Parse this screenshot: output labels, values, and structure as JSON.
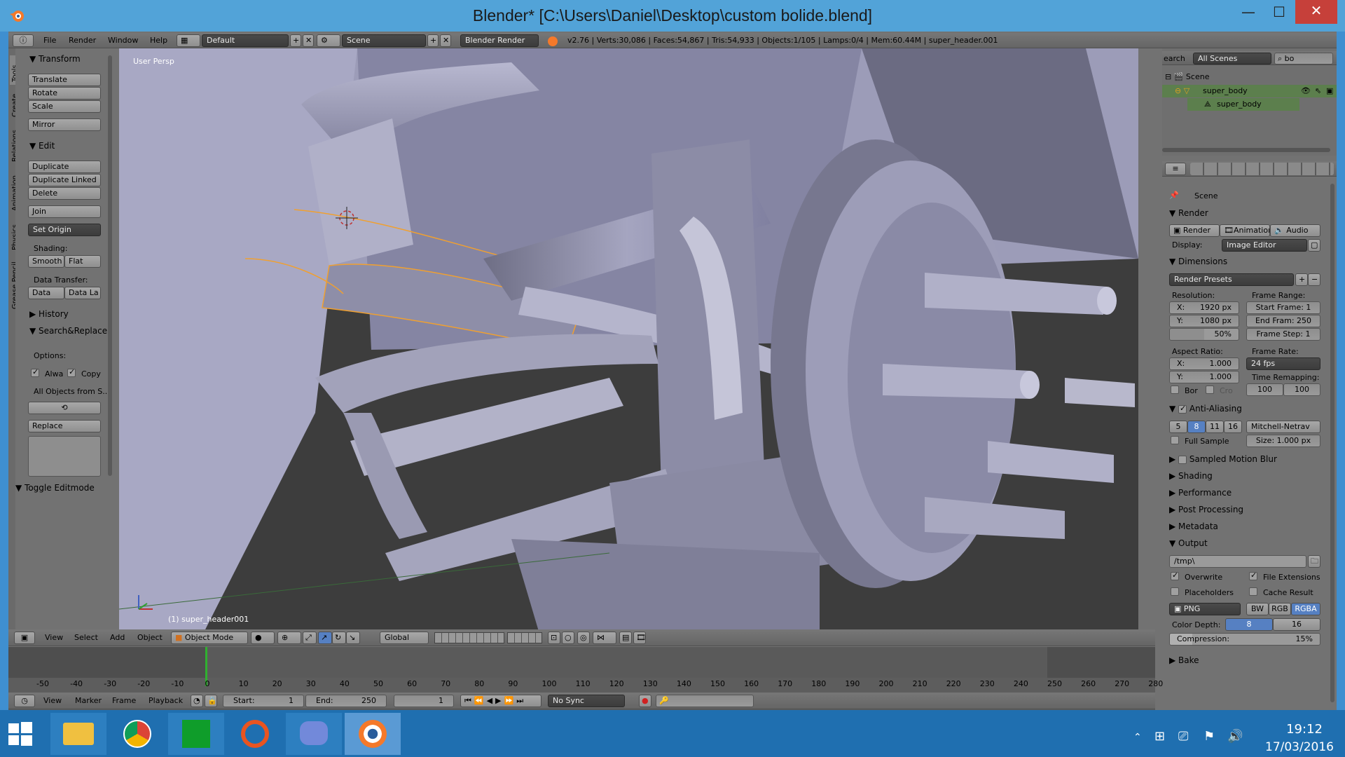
{
  "window": {
    "title": "Blender* [C:\\Users\\Daniel\\Desktop\\custom bolide.blend]"
  },
  "menubar": {
    "items": [
      "File",
      "Render",
      "Window",
      "Help"
    ],
    "layout": "Default",
    "scene": "Scene",
    "engine": "Blender Render",
    "stats": "v2.76 | Verts:30,086 | Faces:54,867 | Tris:54,933 | Objects:1/105 | Lamps:0/4 | Mem:60.44M | super_header.001"
  },
  "tools": {
    "tabs": [
      "Tools",
      "Create",
      "Relations",
      "Animation",
      "Physics",
      "Grease Pencil"
    ],
    "transform_hdr": "Transform",
    "translate": "Translate",
    "rotate": "Rotate",
    "scale": "Scale",
    "mirror": "Mirror",
    "edit_hdr": "Edit",
    "duplicate": "Duplicate",
    "duplicate_linked": "Duplicate Linked",
    "delete": "Delete",
    "join": "Join",
    "set_origin": "Set Origin",
    "shading_lbl": "Shading:",
    "smooth": "Smooth",
    "flat": "Flat",
    "data_transfer_lbl": "Data Transfer:",
    "data": "Data",
    "data_la": "Data La",
    "history_hdr": "History",
    "search_hdr": "Search&Replace",
    "options_lbl": "Options:",
    "alwa": "Alwa",
    "copy": "Copy",
    "all_objects": "All Objects from S...",
    "replace": "Replace",
    "toggle_editmode": "Toggle Editmode"
  },
  "viewport": {
    "view_label": "User Persp",
    "object_label": "(1) super_header001"
  },
  "view_header": {
    "items": [
      "View",
      "Select",
      "Add",
      "Object"
    ],
    "mode": "Object Mode",
    "orientation": "Global"
  },
  "outliner": {
    "search": "earch",
    "filter": "All Scenes",
    "search_value": "bo",
    "scene": "Scene",
    "obj": "super_body",
    "mesh": "super_body"
  },
  "properties": {
    "scene": "Scene",
    "render_hdr": "Render",
    "render_btn": "Render",
    "animation_btn": "Animation",
    "audio_btn": "Audio",
    "display_lbl": "Display:",
    "display_val": "Image Editor",
    "dimensions_hdr": "Dimensions",
    "presets": "Render Presets",
    "resolution_lbl": "Resolution:",
    "res_x": "X:",
    "res_x_val": "1920 px",
    "res_y": "Y:",
    "res_y_val": "1080 px",
    "res_pct": "50%",
    "frame_range_lbl": "Frame Range:",
    "start_frame": "Start Frame: 1",
    "end_frame": "End Fram: 250",
    "frame_step": "Frame Step: 1",
    "aspect_lbl": "Aspect Ratio:",
    "asp_x": "X:",
    "asp_x_val": "1.000",
    "asp_y": "Y:",
    "asp_y_val": "1.000",
    "frame_rate_lbl": "Frame Rate:",
    "fps": "24 fps",
    "time_remap_lbl": "Time Remapping:",
    "remap_a": "100",
    "remap_b": "100",
    "bor": "Bor",
    "cro": "Cro",
    "aa_hdr": "Anti-Aliasing",
    "aa5": "5",
    "aa8": "8",
    "aa11": "11",
    "aa16": "16",
    "filter": "Mitchell-Netrav",
    "full_sample": "Full Sample",
    "size": "Size: 1.000 px",
    "smb_hdr": "Sampled Motion Blur",
    "shading_hdr": "Shading",
    "performance_hdr": "Performance",
    "post_hdr": "Post Processing",
    "metadata_hdr": "Metadata",
    "output_hdr": "Output",
    "output_path": "/tmp\\",
    "overwrite": "Overwrite",
    "file_ext": "File Extensions",
    "placeholders": "Placeholders",
    "cache_result": "Cache Result",
    "format": "PNG",
    "bw": "BW",
    "rgb": "RGB",
    "rgba": "RGBA",
    "color_depth_lbl": "Color Depth:",
    "depth8": "8",
    "depth16": "16",
    "compression": "Compression:",
    "compression_val": "15%",
    "bake_hdr": "Bake"
  },
  "timeline": {
    "items": [
      "View",
      "Marker",
      "Frame",
      "Playback"
    ],
    "start": "Start:",
    "start_val": "1",
    "end": "End:",
    "end_val": "250",
    "current": "1",
    "sync": "No Sync",
    "ticks": [
      "-50",
      "-40",
      "-30",
      "-20",
      "-10",
      "0",
      "10",
      "20",
      "30",
      "40",
      "50",
      "60",
      "70",
      "80",
      "90",
      "100",
      "110",
      "120",
      "130",
      "140",
      "150",
      "160",
      "170",
      "180",
      "190",
      "200",
      "210",
      "220",
      "230",
      "240",
      "250",
      "260",
      "270",
      "280"
    ]
  },
  "taskbar": {
    "time": "19:12",
    "date": "17/03/2016"
  },
  "colors": {
    "accent": "#5680c2",
    "selected_orange": "#f0a030",
    "outliner_sel": "#5c7f4d"
  }
}
